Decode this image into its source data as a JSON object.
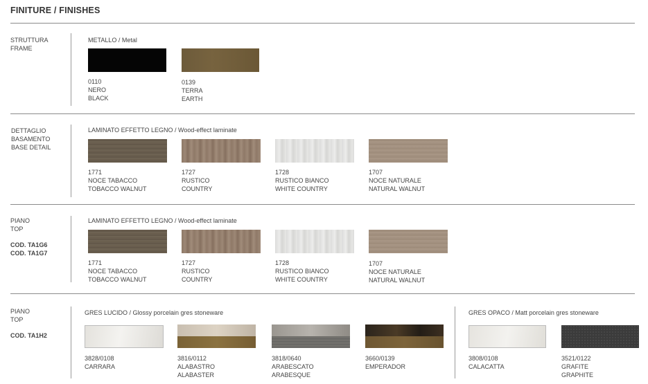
{
  "title": "FINITURE / FINISHES",
  "sections": [
    {
      "label": "STRUTTURA\nFRAME",
      "code": "",
      "group_main": "METALLO",
      "group_sub": " / Metal",
      "items": [
        {
          "code": "0110",
          "it": "NERO",
          "en": "BLACK",
          "swatch": "black"
        },
        {
          "code": "0139",
          "it": "TERRA",
          "en": "EARTH",
          "swatch": "earth"
        }
      ]
    },
    {
      "label": "DETTAGLIO\nBASAMENTO\nBASE DETAIL",
      "code": "",
      "group_main": "LAMINATO EFFETTO LEGNO",
      "group_sub": " / Wood-effect laminate",
      "items": [
        {
          "code": "1771",
          "it": "NOCE TABACCO",
          "en": "TOBACCO WALNUT",
          "swatch": "tobacco"
        },
        {
          "code": "1727",
          "it": "RUSTICO",
          "en": "COUNTRY",
          "swatch": "country"
        },
        {
          "code": "1728",
          "it": "RUSTICO BIANCO",
          "en": "WHITE COUNTRY",
          "swatch": "white"
        },
        {
          "code": "1707",
          "it": "NOCE NATURALE",
          "en": "NATURAL WALNUT",
          "swatch": "natural"
        }
      ]
    },
    {
      "label": "PIANO\nTOP",
      "code": "COD. TA1G6\nCOD. TA1G7",
      "group_main": "LAMINATO EFFETTO LEGNO",
      "group_sub": " / Wood-effect laminate",
      "items": [
        {
          "code": "1771",
          "it": "NOCE TABACCO",
          "en": "TOBACCO WALNUT",
          "swatch": "tobacco"
        },
        {
          "code": "1727",
          "it": "RUSTICO",
          "en": "COUNTRY",
          "swatch": "country"
        },
        {
          "code": "1728",
          "it": "RUSTICO BIANCO",
          "en": "WHITE COUNTRY",
          "swatch": "white"
        },
        {
          "code": "1707",
          "it": "NOCE NATURALE",
          "en": "NATURAL WALNUT",
          "swatch": "natural"
        }
      ]
    },
    {
      "label": "PIANO\nTOP",
      "code": "COD. TA1H2",
      "group_main": "GRES LUCIDO",
      "group_sub": " / Glossy porcelain gres stoneware",
      "group2_main": "GRES OPACO",
      "group2_sub": " / Matt porcelain gres stoneware",
      "items": [
        {
          "code": "3828/0108",
          "it": "CARRARA",
          "en": "",
          "swatch": "carrara"
        },
        {
          "code": "3816/0112",
          "it": "ALABASTRO",
          "en": "ALABASTER",
          "swatch": "alabastro"
        },
        {
          "code": "3818/0640",
          "it": "ARABESCATO",
          "en": "ARABESQUE",
          "swatch": "arabescato"
        },
        {
          "code": "3660/0139",
          "it": "EMPERADOR",
          "en": "",
          "swatch": "emperador"
        },
        {
          "code": "3808/0108",
          "it": "CALACATTA",
          "en": "",
          "swatch": "calacatta"
        },
        {
          "code": "3521/0122",
          "it": "GRAFITE",
          "en": "GRAPHITE",
          "swatch": "graphite"
        }
      ]
    }
  ]
}
